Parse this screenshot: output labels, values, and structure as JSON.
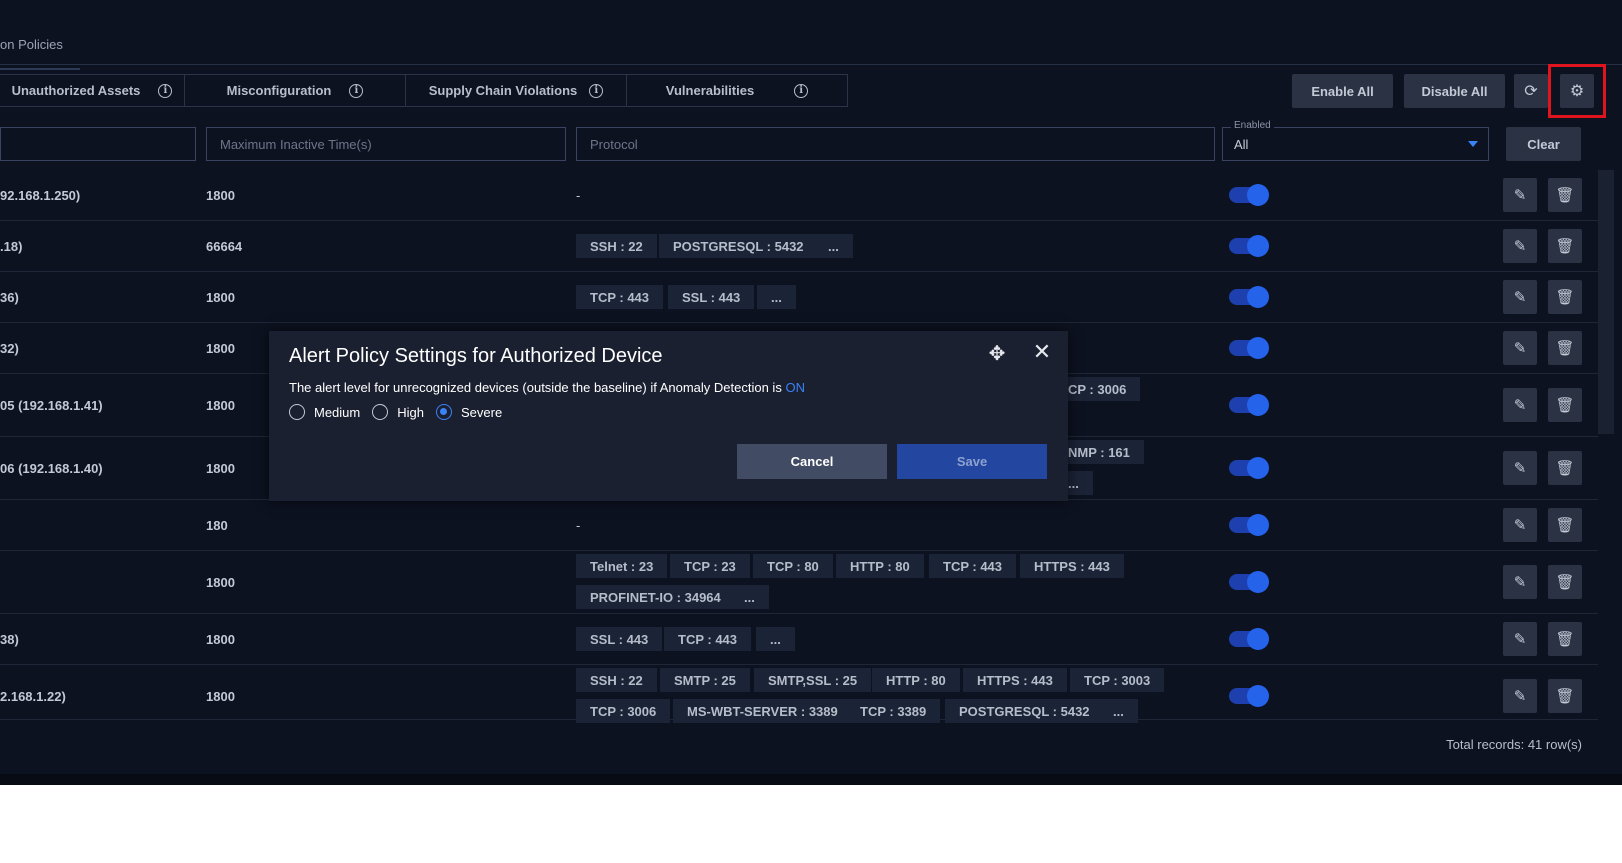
{
  "top_tab": {
    "label": "on Policies"
  },
  "categories": [
    {
      "label": "Unauthorized Assets"
    },
    {
      "label": "Misconfiguration"
    },
    {
      "label": "Supply Chain Violations"
    },
    {
      "label": "Vulnerabilities"
    }
  ],
  "toolbar": {
    "enable_all": "Enable All",
    "disable_all": "Disable All",
    "clear": "Clear"
  },
  "filters": {
    "max_inactive_placeholder": "Maximum Inactive Time(s)",
    "protocol_placeholder": "Protocol",
    "enabled_label": "Enabled",
    "enabled_value": "All"
  },
  "rows": [
    {
      "name": "92.168.1.250)",
      "time": "1800",
      "protocols": [
        "-"
      ]
    },
    {
      "name": ".18)",
      "time": "66664",
      "protocols": [
        "SSH : 22",
        "POSTGRESQL : 5432",
        "..."
      ]
    },
    {
      "name": "36)",
      "time": "1800",
      "protocols": [
        "TCP : 443",
        "SSL : 443",
        "..."
      ]
    },
    {
      "name": "32)",
      "time": "1800",
      "protocols": []
    },
    {
      "name": "05 (192.168.1.41)",
      "time": "1800",
      "protocols": [
        "CP : 3006"
      ]
    },
    {
      "name": "06 (192.168.1.40)",
      "time": "1800",
      "protocols": [
        "NMP : 161",
        "..."
      ]
    },
    {
      "name": "",
      "time": "180",
      "protocols": [
        "-"
      ]
    },
    {
      "name": "",
      "time": "1800",
      "protocols": [
        "Telnet : 23",
        "TCP : 23",
        "TCP : 80",
        "HTTP : 80",
        "TCP : 443",
        "HTTPS : 443",
        "PROFINET-IO : 34964",
        "..."
      ]
    },
    {
      "name": "38)",
      "time": "1800",
      "protocols": [
        "SSL : 443",
        "TCP : 443",
        "..."
      ]
    },
    {
      "name": "2.168.1.22)",
      "time": "1800",
      "protocols": [
        "SSH : 22",
        "SMTP : 25",
        "SMTP,SSL : 25",
        "HTTP : 80",
        "HTTPS : 443",
        "TCP : 3003",
        "TCP : 3006",
        "MS-WBT-SERVER : 3389",
        "TCP : 3389",
        "POSTGRESQL : 5432",
        "..."
      ]
    }
  ],
  "footer": {
    "total": "Total records: 41 row(s)"
  },
  "modal": {
    "title": "Alert Policy Settings for Authorized Device",
    "desc": "The alert level for unrecognized devices (outside the baseline) if Anomaly Detection is",
    "status": "ON",
    "options": [
      "Medium",
      "High",
      "Severe"
    ],
    "selected": "Severe",
    "cancel": "Cancel",
    "save": "Save"
  },
  "colors": {
    "background": "#0d1220",
    "accent": "#3b82f6",
    "highlight": "#e0141c"
  }
}
